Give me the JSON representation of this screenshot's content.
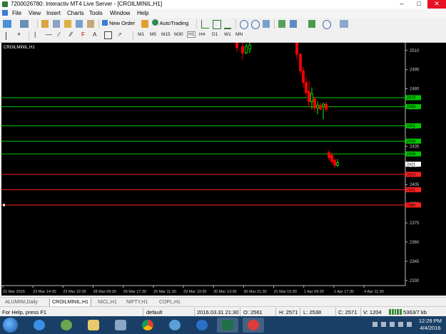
{
  "window": {
    "title": "7200026780: Interactiv MT4 Live Server - [CROILMINIL,H1]"
  },
  "menu": [
    "File",
    "View",
    "Insert",
    "Charts",
    "Tools",
    "Window",
    "Help"
  ],
  "toolbar": {
    "new_order": "New Order",
    "auto_trading": "AutoTrading"
  },
  "timeframes": [
    "M1",
    "M5",
    "M15",
    "M30",
    "H1",
    "H4",
    "D1",
    "W1",
    "MN"
  ],
  "search": {
    "value": ""
  },
  "chart": {
    "label": "CROILMINIL,H1",
    "background": "#000000",
    "bull_color": "#00ff00",
    "bear_color": "#ff0000"
  },
  "chart_data": {
    "type": "line",
    "symbol": "CROILMINIL",
    "timeframe": "H1",
    "ylim": [
      2326,
      2516
    ],
    "y_ticks": [
      2510,
      2495,
      2480,
      2465,
      2450,
      2435,
      2420,
      2405,
      2390,
      2375,
      2360,
      2345,
      2330
    ],
    "x_tick_labels": [
      "22 Mar 2016",
      "23 Mar 14:30",
      "23 Mar 22:30",
      "28 Mar 09:30",
      "28 Mar 17:30",
      "29 Mar 11:30",
      "29 Mar 19:30",
      "30 Mar 13:30",
      "30 Mar 21:30",
      "31 Mar 15:30",
      "1 Apr 09:30",
      "1 Apr 17:30",
      "4 Apr 11:30"
    ],
    "horizontal_levels": [
      {
        "price": 2473,
        "color": "#00c800",
        "label": "2473"
      },
      {
        "price": 2466,
        "color": "#00c800",
        "label": "2466"
      },
      {
        "price": 2451,
        "color": "#00c800",
        "label": "2451"
      },
      {
        "price": 2439,
        "color": "#00c800",
        "label": "2439"
      },
      {
        "price": 2429,
        "color": "#00c800",
        "label": "2429"
      },
      {
        "price": 2413,
        "color": "#ff2020",
        "label": "2413"
      },
      {
        "price": 2401,
        "color": "#ff2020",
        "label": "2401"
      },
      {
        "price": 2389,
        "color": "#ff2020",
        "label": "2389"
      }
    ],
    "bid": {
      "price": 2421,
      "label": "2421"
    },
    "candles": [
      {
        "x": 330,
        "o": 2516,
        "h": 2517,
        "l": 2509,
        "c": 2512
      },
      {
        "x": 338,
        "o": 2513,
        "h": 2517,
        "l": 2503,
        "c": 2508
      },
      {
        "x": 343,
        "o": 2508,
        "h": 2515,
        "l": 2507,
        "c": 2513
      },
      {
        "x": 348,
        "o": 2511,
        "h": 2516,
        "l": 2508,
        "c": 2514
      },
      {
        "x": 414,
        "o": 2516,
        "h": 2517,
        "l": 2503,
        "c": 2507
      },
      {
        "x": 419,
        "o": 2507,
        "h": 2508,
        "l": 2491,
        "c": 2494
      },
      {
        "x": 423,
        "o": 2494,
        "h": 2497,
        "l": 2481,
        "c": 2485
      },
      {
        "x": 427,
        "o": 2485,
        "h": 2489,
        "l": 2474,
        "c": 2477
      },
      {
        "x": 431,
        "o": 2478,
        "h": 2486,
        "l": 2465,
        "c": 2470
      },
      {
        "x": 435,
        "o": 2470,
        "h": 2481,
        "l": 2464,
        "c": 2476
      },
      {
        "x": 439,
        "o": 2472,
        "h": 2474,
        "l": 2462,
        "c": 2465
      },
      {
        "x": 443,
        "o": 2465,
        "h": 2470,
        "l": 2460,
        "c": 2467
      },
      {
        "x": 447,
        "o": 2467,
        "h": 2469,
        "l": 2463,
        "c": 2464
      },
      {
        "x": 451,
        "o": 2466,
        "h": 2469,
        "l": 2456,
        "c": 2468
      },
      {
        "x": 455,
        "o": 2468,
        "h": 2470,
        "l": 2462,
        "c": 2464
      },
      {
        "x": 459,
        "o": 2430,
        "h": 2432,
        "l": 2424,
        "c": 2426
      },
      {
        "x": 463,
        "o": 2428,
        "h": 2430,
        "l": 2421,
        "c": 2423
      },
      {
        "x": 467,
        "o": 2424,
        "h": 2426,
        "l": 2418,
        "c": 2420
      },
      {
        "x": 471,
        "o": 2420,
        "h": 2425,
        "l": 2419,
        "c": 2422
      }
    ]
  },
  "tabs": [
    {
      "label": "ALUMINI,Daily",
      "active": false
    },
    {
      "label": "CROILMINIL,H1",
      "active": true
    },
    {
      "label": "NICL,H1",
      "active": false
    },
    {
      "label": "NIFTY,H1",
      "active": false
    },
    {
      "label": "COPL,H1",
      "active": false
    }
  ],
  "status": {
    "help": "For Help, press F1",
    "profile": "default",
    "datetime": "2016.03.31 21:30",
    "open": "O: 2561",
    "high": "H: 2571",
    "low": "L: 2538",
    "close": "C: 2571",
    "volume": "V: 1204",
    "traffic": "5363/7 kb"
  },
  "taskbar": {
    "time": "12:29 PM",
    "date": "4/4/2016"
  }
}
